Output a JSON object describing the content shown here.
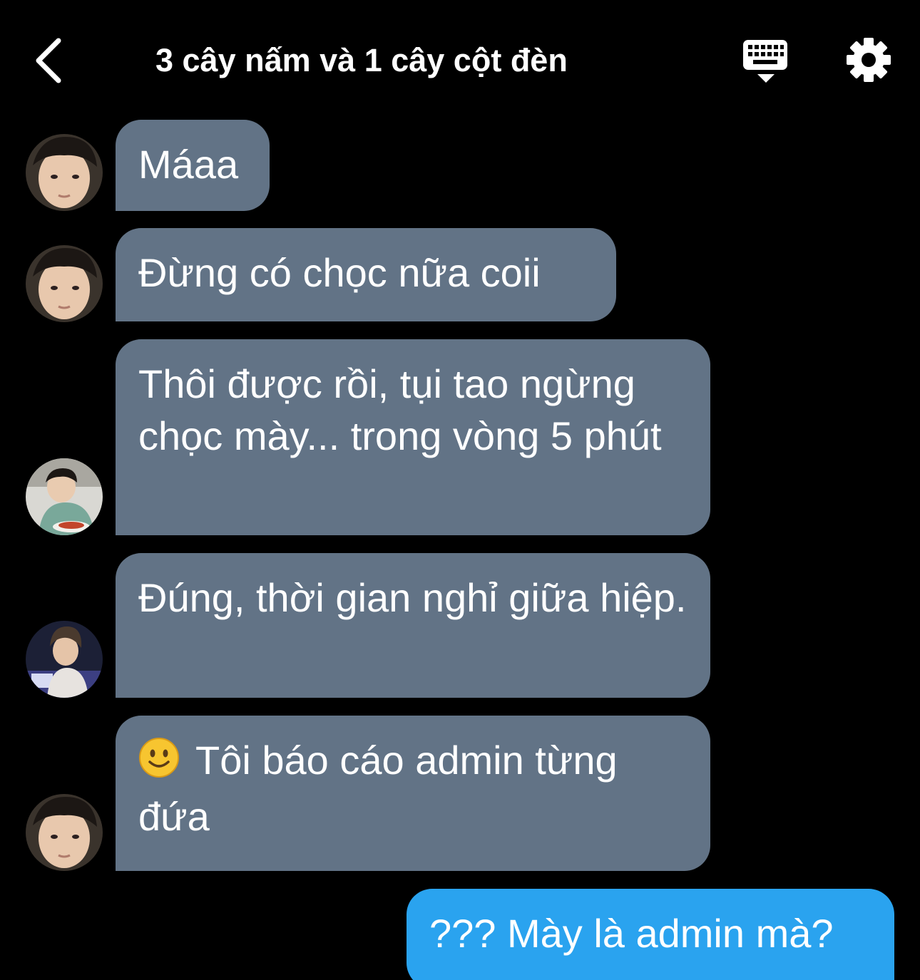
{
  "header": {
    "title": "3 cây nấm và 1 cây cột đèn",
    "back_icon": "chevron-left-icon",
    "keyboard_icon": "keyboard-hide-icon",
    "settings_icon": "gear-icon"
  },
  "messages": [
    {
      "sender": "avatar-1",
      "text": "Máaa"
    },
    {
      "sender": "avatar-1",
      "text": "Đừng có chọc nữa coii"
    },
    {
      "sender": "avatar-2",
      "text": "Thôi được rồi, tụi tao ngừng chọc mày... trong vòng 5 phút"
    },
    {
      "sender": "avatar-3",
      "text": "Đúng, thời gian nghỉ giữa hiệp."
    },
    {
      "sender": "avatar-1",
      "emoji": "slightly-smiling-face-icon",
      "text": "Tôi báo cáo admin từng đứa"
    },
    {
      "sender": "me",
      "text": "??? Mày là admin mà?"
    }
  ],
  "colors": {
    "background": "#000000",
    "incoming_bubble": "#627386",
    "outgoing_bubble": "#2aa3ef",
    "text": "#ffffff"
  }
}
